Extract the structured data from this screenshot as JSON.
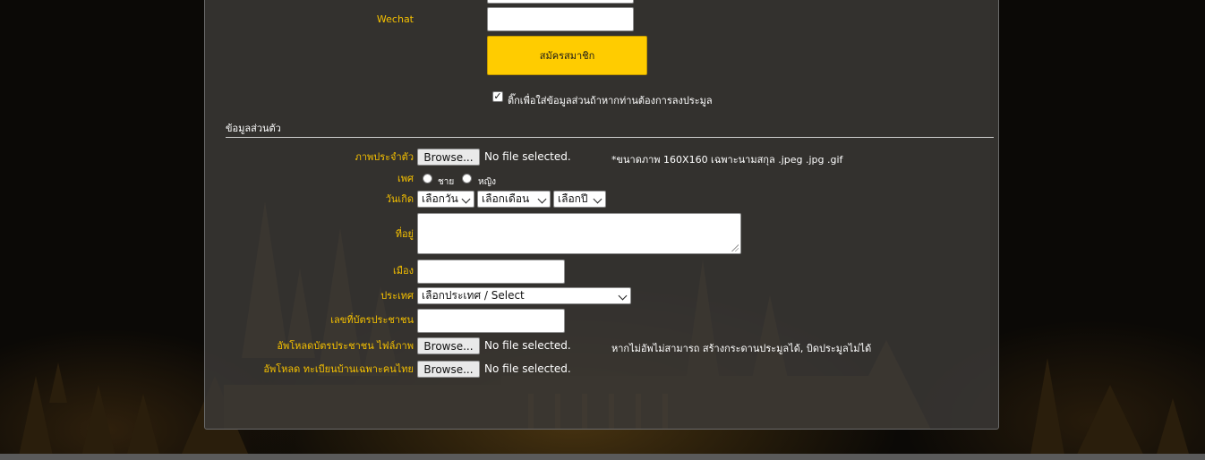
{
  "form": {
    "wechat_label": "Wechat",
    "submit_label": "สมัครสมาชิก",
    "personal_checkbox_label": "ติ๊กเพื่อใส่ข้อมูลส่วนถ้าหากท่านต้องการลงประมูล",
    "personal_checkbox_checked": true
  },
  "personal": {
    "section_title": "ข้อมูลส่วนตัว",
    "photo_label": "ภาพประจำตัว",
    "browse_label": "Browse...",
    "no_file_text": "No file selected.",
    "photo_note": "*ขนาดภาพ 160X160 เฉพาะนามสกุล .jpeg .jpg .gif",
    "gender_label": "เพศ",
    "gender_male": "ชาย",
    "gender_female": "หญิง",
    "birthdate_label": "วันเกิด",
    "day_select": "เลือกวัน",
    "month_select": "เลือกเดือน",
    "year_select": "เลือกปี",
    "address_label": "ที่อยู่",
    "city_label": "เมือง",
    "country_label": "ประเทศ",
    "country_select": "เลือกประเทศ / Select",
    "id_number_label": "เลขที่บัตรประชาชน",
    "id_upload_label": "อัพโหลดบัตรประชาชน ไฟล์ภาพ",
    "id_upload_note": "หากไม่อัพไม่สามารถ สร้างกระดานประมูลได้, บิดประมูลไม่ได้",
    "house_upload_label": "อัพโหลด ทะเบียนบ้านเฉพาะคนไทย"
  },
  "colors": {
    "label_yellow": "#f5c000",
    "button_yellow": "#ffcc00",
    "panel_bg": "#3a3836"
  },
  "icons": {
    "checkbox": "checkmark",
    "select": "chevron-down-icon"
  }
}
